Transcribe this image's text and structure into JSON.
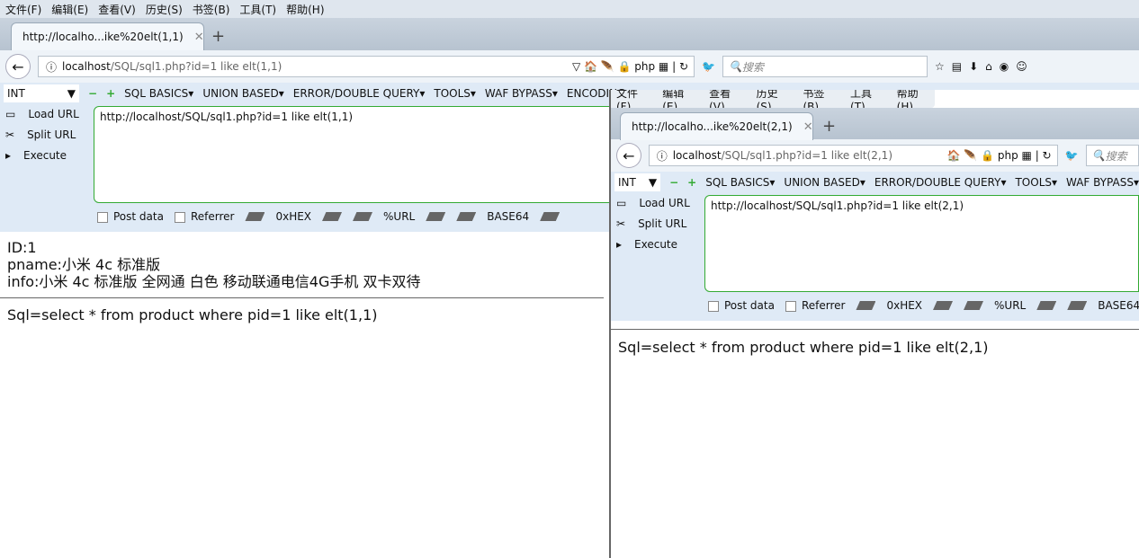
{
  "menu": [
    "文件(F)",
    "编辑(E)",
    "查看(V)",
    "历史(S)",
    "书签(B)",
    "工具(T)",
    "帮助(H)"
  ],
  "hackbar": {
    "select": "INT",
    "menus": [
      "SQL BASICS▾",
      "UNION BASED▾",
      "ERROR/DOUBLE QUERY▾",
      "TOOLS▾",
      "WAF BYPASS▾",
      "ENCODING▾"
    ],
    "load": "Load URL",
    "split": "Split URL",
    "execute": "Execute",
    "post": "Post data",
    "referrer": "Referrer",
    "hex": "0xHEX",
    "urlenc": "%URL",
    "b64": "BASE64"
  },
  "search_placeholder": "搜索",
  "left": {
    "tab": "http://localho...ike%20elt(1,1)",
    "host": "localhost",
    "path": "/SQL/sql1.php?id=1 like elt(1,1)",
    "textarea": "http://localhost/SQL/sql1.php?id=1 like elt(1,1)",
    "id": "ID:1",
    "pname": "pname:小米 4c 标准版",
    "info": "info:小米 4c 标准版 全网通 白色 移动联通电信4G手机 双卡双待",
    "sql": "Sql=select * from product where pid=1 like elt(1,1)"
  },
  "right": {
    "tab": "http://localho...ike%20elt(2,1)",
    "host": "localhost",
    "path": "/SQL/sql1.php?id=1 like elt(2,1)",
    "textarea": "http://localhost/SQL/sql1.php?id=1 like elt(2,1)",
    "sql": "Sql=select * from product where pid=1 like elt(2,1)"
  }
}
